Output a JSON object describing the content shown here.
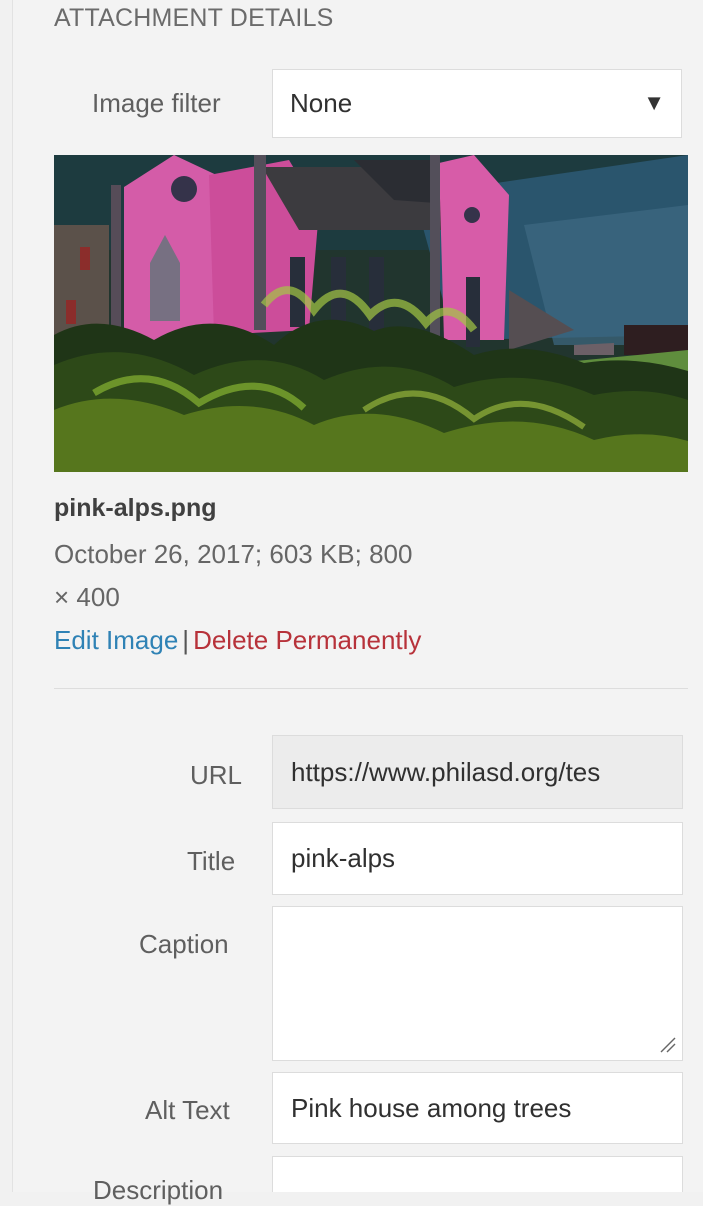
{
  "panel": {
    "heading": "ATTACHMENT DETAILS"
  },
  "image_filter": {
    "label": "Image filter",
    "selected": "None",
    "arrow_icon": "triangle-down-icon"
  },
  "attachment": {
    "preview_alt": "Pink house among trees",
    "file_name": "pink-alps.png",
    "meta_line1": "October 26, 2017; 603 KB; 800",
    "meta_line2": "× 400",
    "edit_label": "Edit Image",
    "separator": "|",
    "delete_label": "Delete Permanently"
  },
  "fields": {
    "url": {
      "label": "URL",
      "value": "https://www.philasd.org/tes"
    },
    "title": {
      "label": "Title",
      "value": "pink-alps"
    },
    "caption": {
      "label": "Caption",
      "value": ""
    },
    "alt_text": {
      "label": "Alt Text",
      "value": "Pink house among trees"
    },
    "description": {
      "label": "Description",
      "value": ""
    }
  },
  "colors": {
    "edit_link": "#2f82b5",
    "delete_link": "#b7323a",
    "panel_bg": "#f3f3f3"
  }
}
